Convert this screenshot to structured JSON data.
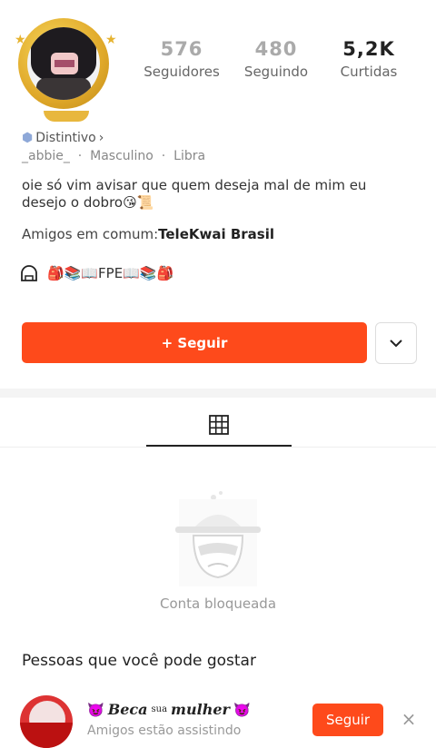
{
  "profile": {
    "stats": [
      {
        "value": "576",
        "label": "Seguidores"
      },
      {
        "value": "480",
        "label": "Seguindo"
      },
      {
        "value": "5,2K",
        "label": "Curtidas"
      }
    ],
    "badge_label": "Distintivo",
    "badge_chevron": "›",
    "username": "_abbie_",
    "gender": "Masculino",
    "zodiac": "Libra",
    "meta_separator": "·",
    "bio": "oie só vim avisar que quem deseja mal de mim eu desejo o dobro😘📜",
    "mutual_prefix": "Amigos em comum:",
    "mutual_names": "TeleKwai Brasil",
    "store_text": "🎒📚📖FPE📖📚🎒"
  },
  "actions": {
    "follow_label": "+ Seguir",
    "more_icon": "chevron-down-icon"
  },
  "tabs": {
    "active_icon": "grid-icon"
  },
  "locked": {
    "text": "Conta bloqueada"
  },
  "suggestions": {
    "title": "Pessoas que você pode gostar",
    "items": [
      {
        "name_part1": "Beca",
        "name_sup": "sua",
        "name_part2": "mulher",
        "emoji": "😈",
        "subtitle": "Amigos estão assistindo",
        "follow_label": "Seguir",
        "close": "×"
      }
    ]
  },
  "colors": {
    "accent": "#fe4a1b",
    "gold": "#e0a92a"
  }
}
